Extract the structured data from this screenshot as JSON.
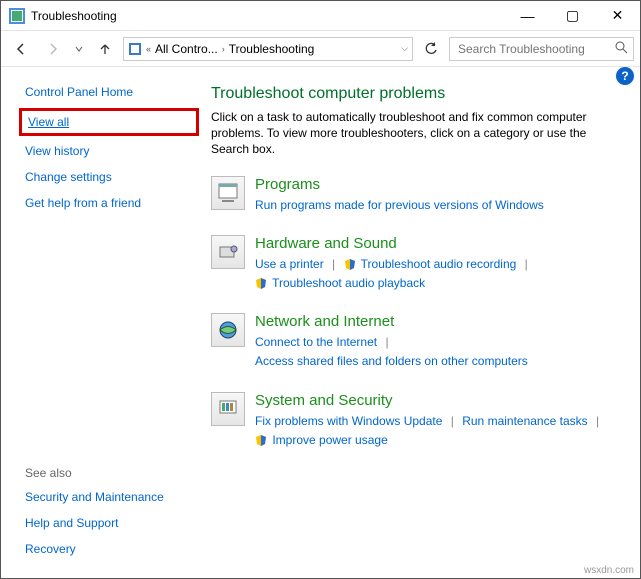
{
  "window": {
    "title": "Troubleshooting"
  },
  "breadcrumb": {
    "seg1": "All Contro...",
    "seg2": "Troubleshooting"
  },
  "search": {
    "placeholder": "Search Troubleshooting"
  },
  "sidebar": {
    "home": "Control Panel Home",
    "view_all": "View all",
    "view_history": "View history",
    "change_settings": "Change settings",
    "get_help": "Get help from a friend",
    "see_also_header": "See also",
    "sec_maint": "Security and Maintenance",
    "help_support": "Help and Support",
    "recovery": "Recovery"
  },
  "main": {
    "heading": "Troubleshoot computer problems",
    "intro": "Click on a task to automatically troubleshoot and fix common computer problems. To view more troubleshooters, click on a category or use the Search box.",
    "programs": {
      "title": "Programs",
      "l1": "Run programs made for previous versions of Windows"
    },
    "hardware": {
      "title": "Hardware and Sound",
      "l1": "Use a printer",
      "l2": "Troubleshoot audio recording",
      "l3": "Troubleshoot audio playback"
    },
    "network": {
      "title": "Network and Internet",
      "l1": "Connect to the Internet",
      "l2": "Access shared files and folders on other computers"
    },
    "system": {
      "title": "System and Security",
      "l1": "Fix problems with Windows Update",
      "l2": "Run maintenance tasks",
      "l3": "Improve power usage"
    }
  },
  "watermark": "wsxdn.com"
}
